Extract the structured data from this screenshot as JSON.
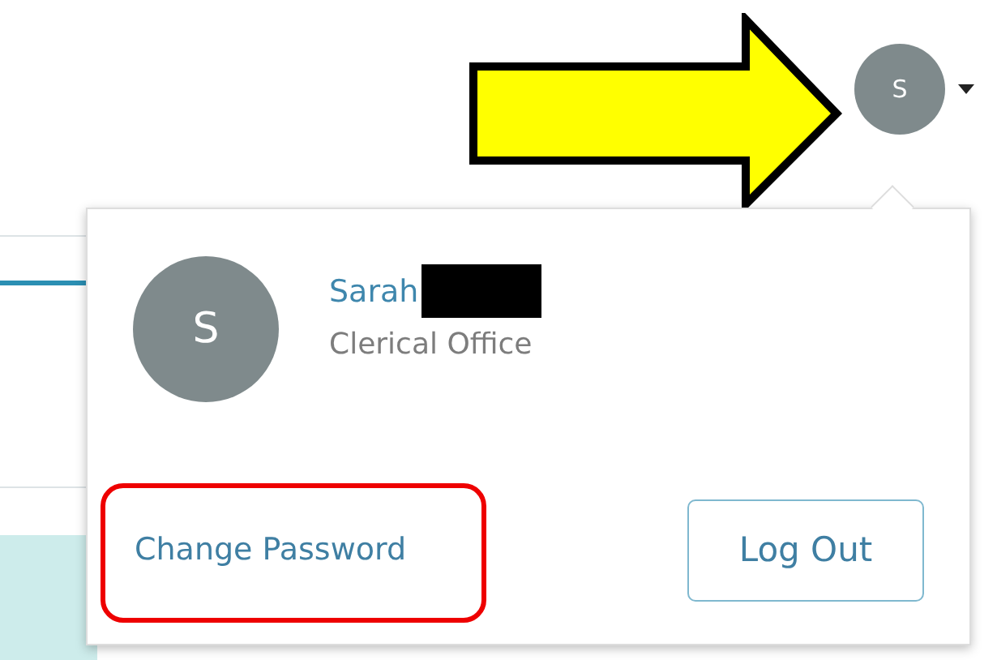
{
  "header": {
    "avatar_initial": "S"
  },
  "menu": {
    "avatar_initial": "S",
    "name": "Sarah",
    "role": "Clerical Office",
    "change_password": "Change Password",
    "log_out": "Log Out"
  }
}
